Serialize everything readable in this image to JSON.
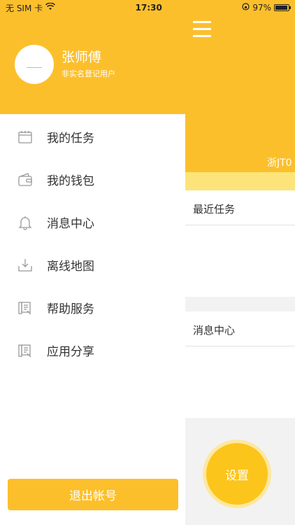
{
  "status_bar": {
    "carrier": "无 SIM 卡",
    "time": "17:30",
    "battery": "97%",
    "battery_level": 0.97
  },
  "drawer": {
    "user_name": "张师傅",
    "user_status": "非实名登记用户",
    "menu": [
      {
        "label": "我的任务",
        "icon": "calendar-icon"
      },
      {
        "label": "我的钱包",
        "icon": "wallet-icon"
      },
      {
        "label": "消息中心",
        "icon": "bell-icon"
      },
      {
        "label": "离线地图",
        "icon": "download-icon"
      },
      {
        "label": "帮助服务",
        "icon": "help-document-icon"
      },
      {
        "label": "应用分享",
        "icon": "share-document-icon"
      }
    ],
    "logout_label": "退出帐号"
  },
  "main": {
    "plate_text": "浙JT0",
    "recent_tasks_title": "最近任务",
    "messages_title": "消息中心",
    "settings_label": "设置"
  },
  "colors": {
    "accent": "#fcbf2c",
    "accent_light": "#fde47a"
  }
}
